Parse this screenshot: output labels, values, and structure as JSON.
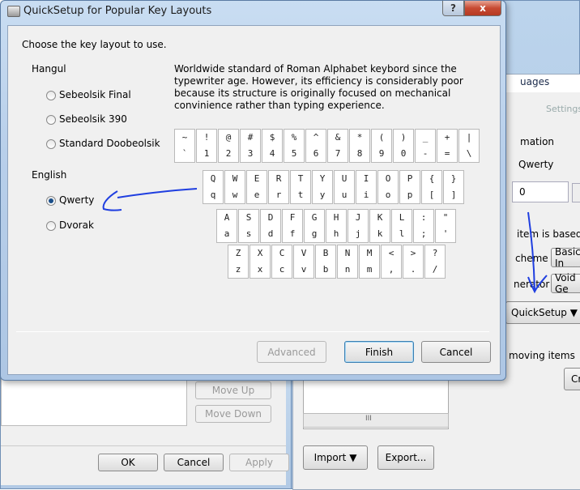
{
  "dialog": {
    "title": "QuickSetup for Popular Key Layouts",
    "prompt": "Choose the key layout to use.",
    "help_icon": "?",
    "close_icon": "x",
    "hangul_label": "Hangul",
    "english_label": "English",
    "options": {
      "sebeolsik_final": "Sebeolsik Final",
      "sebeolsik_390": "Sebeolsik 390",
      "standard_doobeolsik": "Standard Doobeolsik",
      "qwerty": "Qwerty",
      "dvorak": "Dvorak"
    },
    "selected": "Qwerty",
    "description": "Worldwide standard of Roman Alphabet keybord since the typewriter age. However, its efficiency is considerably poor because its structure is originally focused on mechanical convinience rather than typing experience.",
    "buttons": {
      "advanced": "Advanced",
      "finish": "Finish",
      "cancel": "Cancel"
    }
  },
  "keyboard": {
    "rows": [
      [
        [
          "~",
          "`"
        ],
        [
          "!",
          "1"
        ],
        [
          "@",
          "2"
        ],
        [
          "#",
          "3"
        ],
        [
          "$",
          "4"
        ],
        [
          "%",
          "5"
        ],
        [
          "^",
          "6"
        ],
        [
          "&",
          "7"
        ],
        [
          "*",
          "8"
        ],
        [
          "(",
          "9"
        ],
        [
          ")",
          "0"
        ],
        [
          "_",
          "-"
        ],
        [
          "+",
          "="
        ],
        [
          "|",
          "\\"
        ]
      ],
      [
        [
          "Q",
          "q"
        ],
        [
          "W",
          "w"
        ],
        [
          "E",
          "e"
        ],
        [
          "R",
          "r"
        ],
        [
          "T",
          "t"
        ],
        [
          "Y",
          "y"
        ],
        [
          "U",
          "u"
        ],
        [
          "I",
          "i"
        ],
        [
          "O",
          "o"
        ],
        [
          "P",
          "p"
        ],
        [
          "{",
          "["
        ],
        [
          "}",
          "]"
        ]
      ],
      [
        [
          "A",
          "a"
        ],
        [
          "S",
          "s"
        ],
        [
          "D",
          "d"
        ],
        [
          "F",
          "f"
        ],
        [
          "G",
          "g"
        ],
        [
          "H",
          "h"
        ],
        [
          "J",
          "j"
        ],
        [
          "K",
          "k"
        ],
        [
          "L",
          "l"
        ],
        [
          ":",
          ";"
        ],
        [
          "\"",
          "'"
        ]
      ],
      [
        [
          "Z",
          "z"
        ],
        [
          "X",
          "x"
        ],
        [
          "C",
          "c"
        ],
        [
          "V",
          "v"
        ],
        [
          "B",
          "b"
        ],
        [
          "N",
          "n"
        ],
        [
          "M",
          "m"
        ],
        [
          "<",
          ","
        ],
        [
          ">",
          "."
        ],
        [
          "?",
          "/"
        ]
      ]
    ]
  },
  "background": {
    "left": {
      "move_up": "Move Up",
      "move_down": "Move Down",
      "ok": "OK",
      "cancel": "Cancel",
      "apply": "Apply"
    },
    "right": {
      "languages_fragment": "uages",
      "settings_fragment": "Settings",
      "information_fragment": "mation",
      "qwerty": "Qwerty",
      "number_value": "0",
      "based_on_fragment": "item is based on",
      "scheme_fragment": "cheme",
      "generator_fragment": "nerator",
      "basic_input": "Basic In",
      "void_gen": "Void Ge",
      "quicksetup": "QuickSetup ▼",
      "removing_fragment": "moving items",
      "create_fragment": "Cre",
      "scroll_mark": "III",
      "import": "Import ▼",
      "export": "Export..."
    }
  }
}
